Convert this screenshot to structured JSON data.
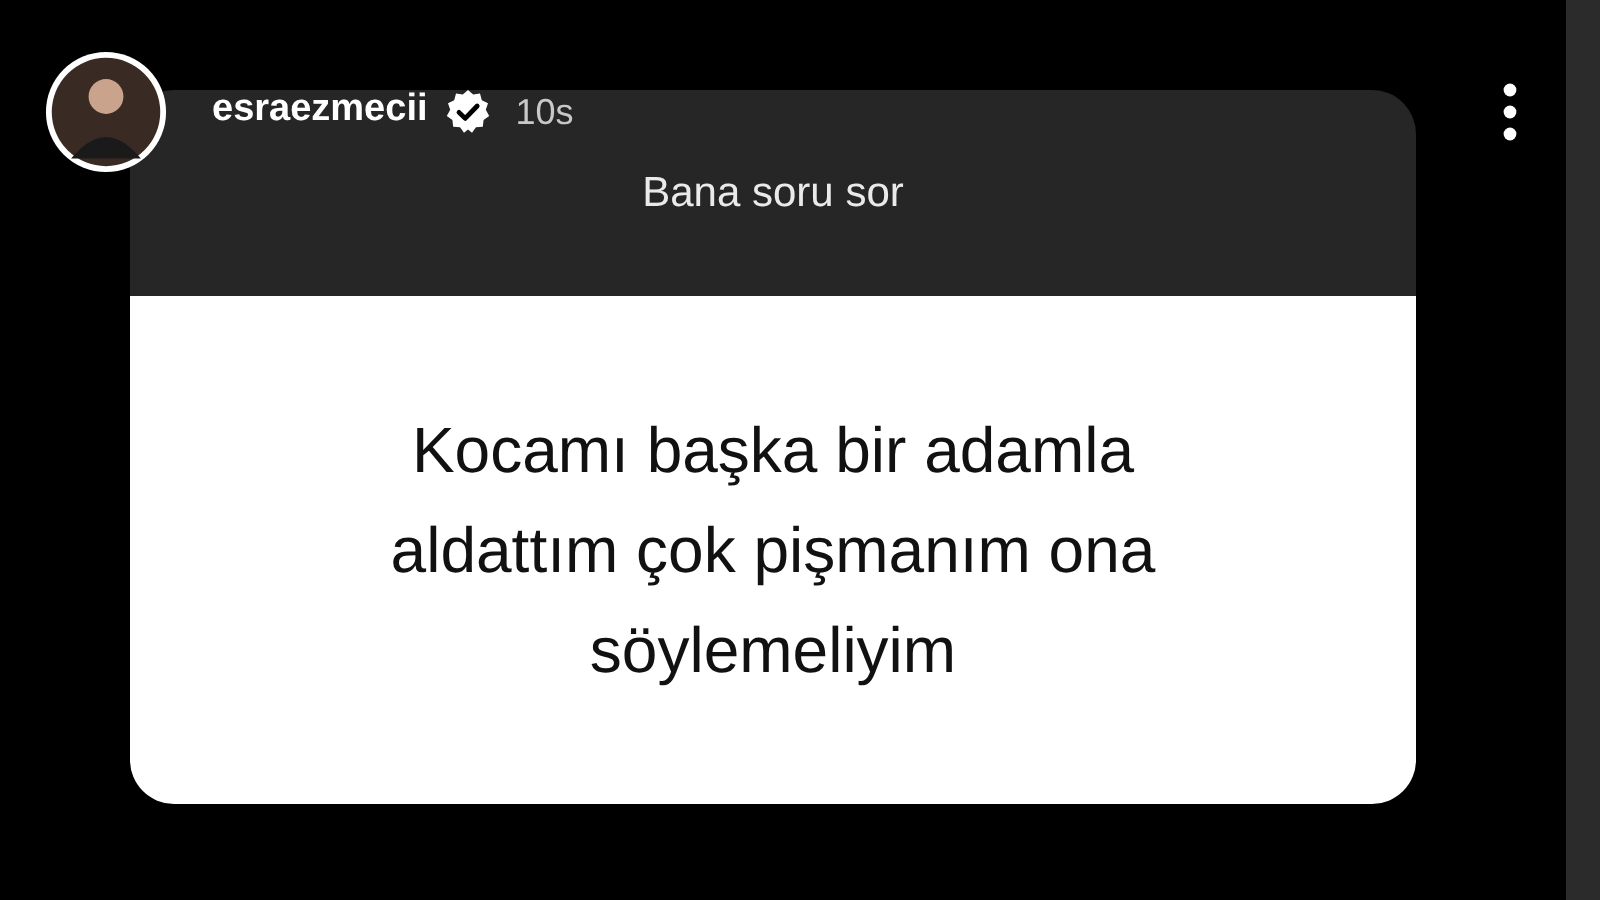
{
  "story": {
    "username": "esraezmecii",
    "verified": true,
    "time": "10s"
  },
  "question_card": {
    "title": "Bana soru sor",
    "question": "Kocamı başka bir adamla\naldattım çok pişmanım ona\nsöylemeliyim"
  }
}
